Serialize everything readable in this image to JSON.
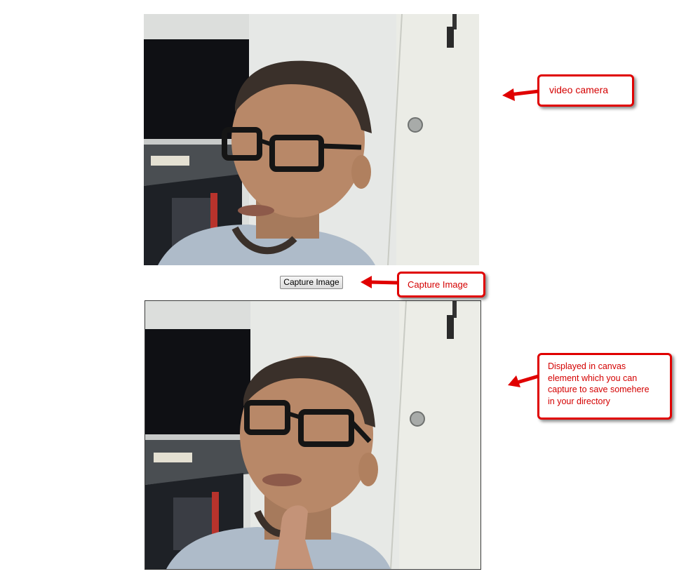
{
  "capture_button": {
    "label": "Capture Image"
  },
  "annotations": {
    "video": {
      "text": "video camera"
    },
    "capture": {
      "text": "Capture Image"
    },
    "canvas": {
      "lines": [
        "Displayed in canvas",
        "element which you can",
        "capture to save somehere",
        "in your directory"
      ]
    }
  },
  "colors": {
    "callout_red": "#e00000",
    "callout_text": "#d40000"
  }
}
